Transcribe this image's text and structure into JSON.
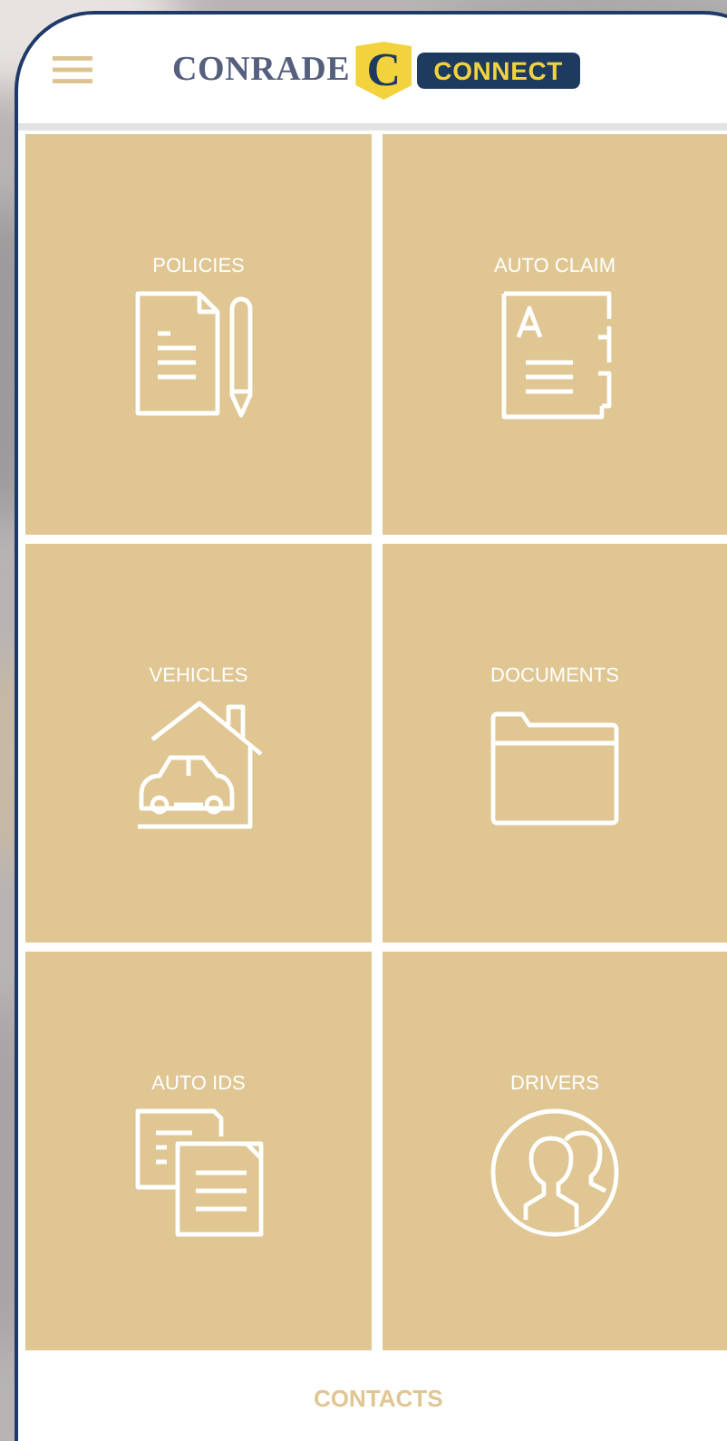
{
  "logo": {
    "name": "CONRADE",
    "emblem": "C",
    "badge": "CONNECT"
  },
  "tiles": [
    {
      "label": "POLICIES",
      "kind": "policies"
    },
    {
      "label": "AUTO CLAIM",
      "kind": "claim"
    },
    {
      "label": "VEHICLES",
      "kind": "vehicles"
    },
    {
      "label": "DOCUMENTS",
      "kind": "documents"
    },
    {
      "label": "AUTO IDS",
      "kind": "ids"
    },
    {
      "label": "DRIVERS",
      "kind": "drivers"
    }
  ],
  "footer": {
    "link": "CONTACTS"
  }
}
